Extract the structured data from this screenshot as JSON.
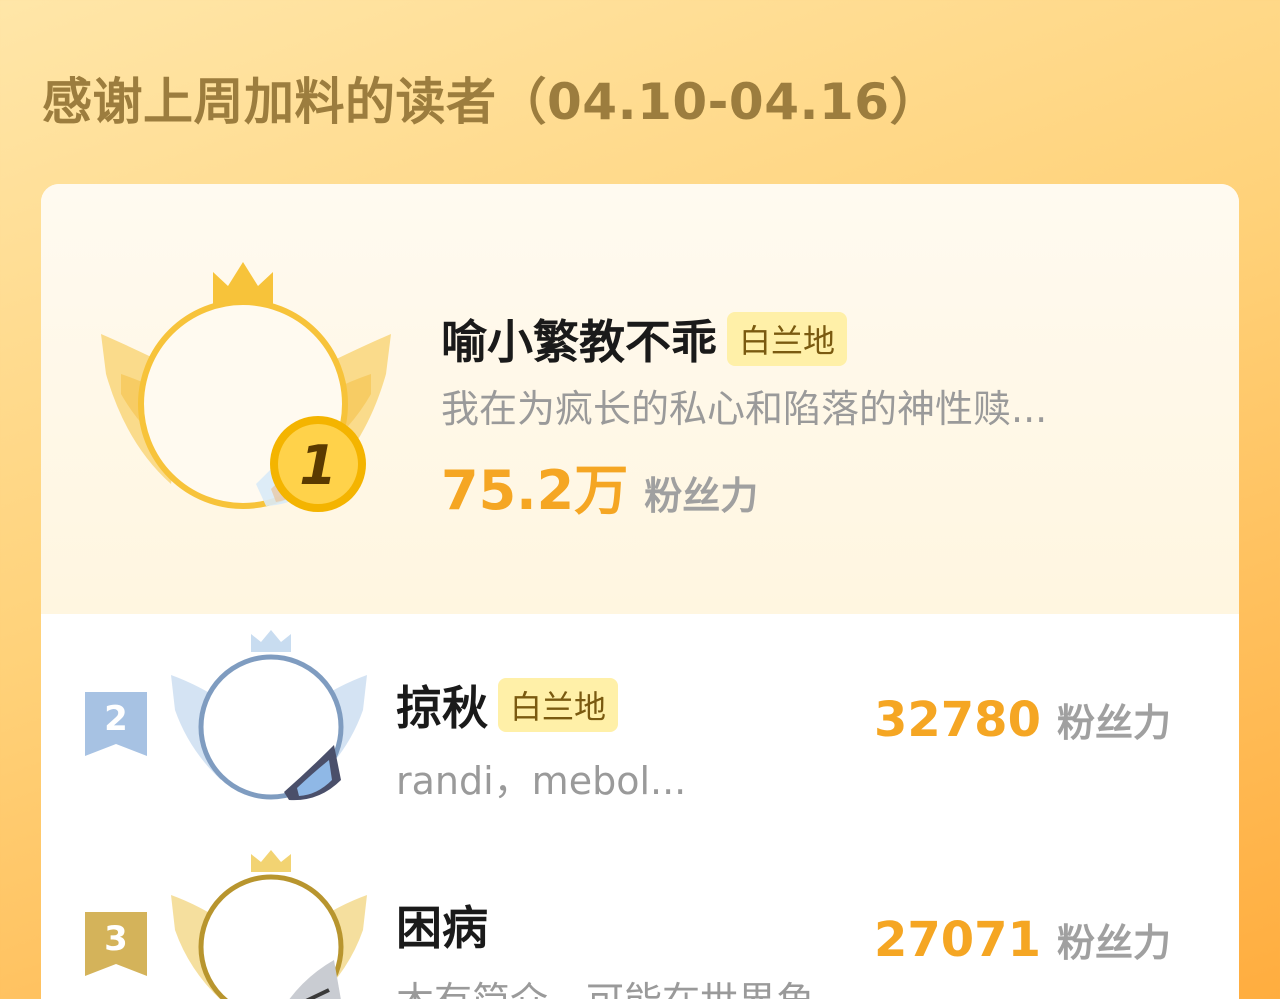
{
  "header": {
    "title": "感谢上周加料的读者（04.10-04.16）"
  },
  "top_reader": {
    "rank": "1",
    "name": "喻小繁教不乖",
    "badge": "白兰地",
    "description": "我在为疯长的私心和陷落的神性赎...",
    "score": "75.2万",
    "score_unit": "粉丝力"
  },
  "readers": [
    {
      "rank": "2",
      "name": "掠秋",
      "badge": "白兰地",
      "description": "randi，mebol...",
      "score": "32780",
      "score_unit": "粉丝力"
    },
    {
      "rank": "3",
      "name": "困病",
      "badge": "",
      "description": "木有简介，可能在世界角...",
      "score": "27071",
      "score_unit": "粉丝力"
    }
  ],
  "colors": {
    "accent": "#f5a623",
    "title": "#9c7d3e",
    "gold_ring": "#f7c33a",
    "silver_ring": "#7f9cc0",
    "bronze_ring": "#b8952e",
    "badge_bg": "#fff0a8"
  },
  "icons": {
    "top_frame": "gold-crown-wing-frame-icon",
    "rank1_medal": "gold-medal-icon",
    "rank2_flag": "silver-rank-flag-icon",
    "rank3_flag": "bronze-rank-flag-icon"
  }
}
